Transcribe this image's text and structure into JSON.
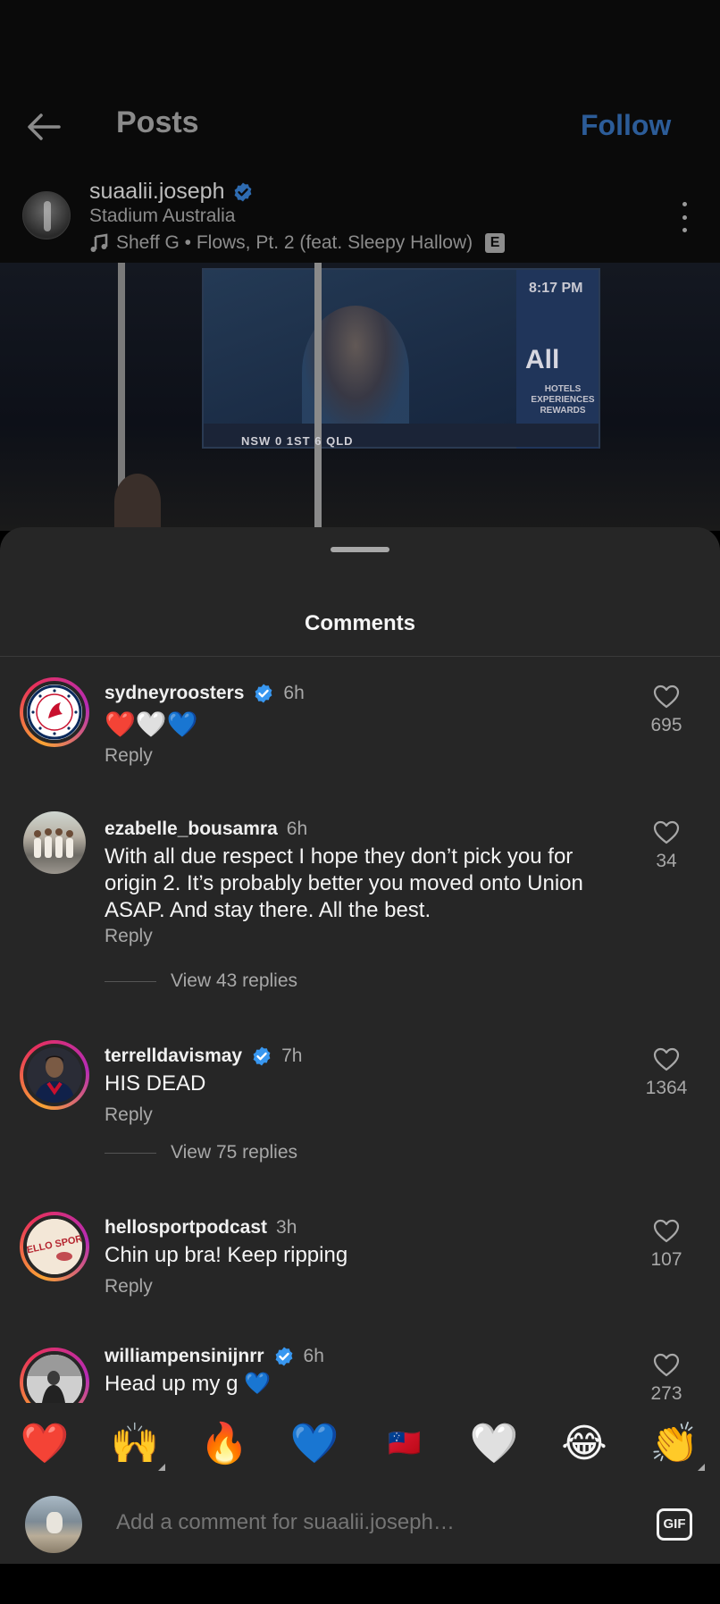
{
  "header": {
    "title": "Posts",
    "follow_label": "Follow"
  },
  "post": {
    "username": "suaalii.joseph",
    "location": "Stadium Australia",
    "music": "Sheff G • Flows, Pt. 2 (feat. Sleepy Hallow)",
    "explicit_label": "E",
    "image_text": {
      "screen_time": "8:17 PM",
      "brand": "All",
      "brand_sub": "HOTELS EXPERIENCES REWARDS",
      "score": "NSW 0 1ST 6 QLD"
    }
  },
  "comments_sheet": {
    "title": "Comments",
    "reply_label": "Reply",
    "comments": [
      {
        "username": "sydneyroosters",
        "verified": true,
        "time": "6h",
        "text": "❤️🤍💙",
        "likes": "695",
        "view_replies": ""
      },
      {
        "username": "ezabelle_bousamra",
        "verified": false,
        "time": "6h",
        "text": "With all due respect I hope they don’t pick you for origin 2. It’s probably better you moved onto Union ASAP. And stay there. All the best.",
        "likes": "34",
        "view_replies": "View 43 replies"
      },
      {
        "username": "terrelldavismay",
        "verified": true,
        "time": "7h",
        "text": "HIS DEAD",
        "likes": "1364",
        "view_replies": "View 75 replies"
      },
      {
        "username": "hellosportpodcast",
        "verified": false,
        "time": "3h",
        "text": "Chin up bra! Keep ripping",
        "likes": "107",
        "view_replies": ""
      },
      {
        "username": "williampensinijnrr",
        "verified": true,
        "time": "6h",
        "text": "Head up my g 💙",
        "likes": "273",
        "view_replies": ""
      }
    ],
    "avatar_labels": {
      "hellosport": "HELLO SPORT"
    }
  },
  "emoji_bar": {
    "emojis": [
      "❤️",
      "🙌",
      "🔥",
      "💙",
      "🇼🇸",
      "🤍",
      "😂",
      "👏"
    ]
  },
  "composer": {
    "placeholder": "Add a comment for suaalii.joseph…",
    "gif_label": "GIF"
  },
  "colors": {
    "accent_blue": "#2c5c98",
    "verified_blue": "#3897f0",
    "sheet_bg": "#262626"
  }
}
